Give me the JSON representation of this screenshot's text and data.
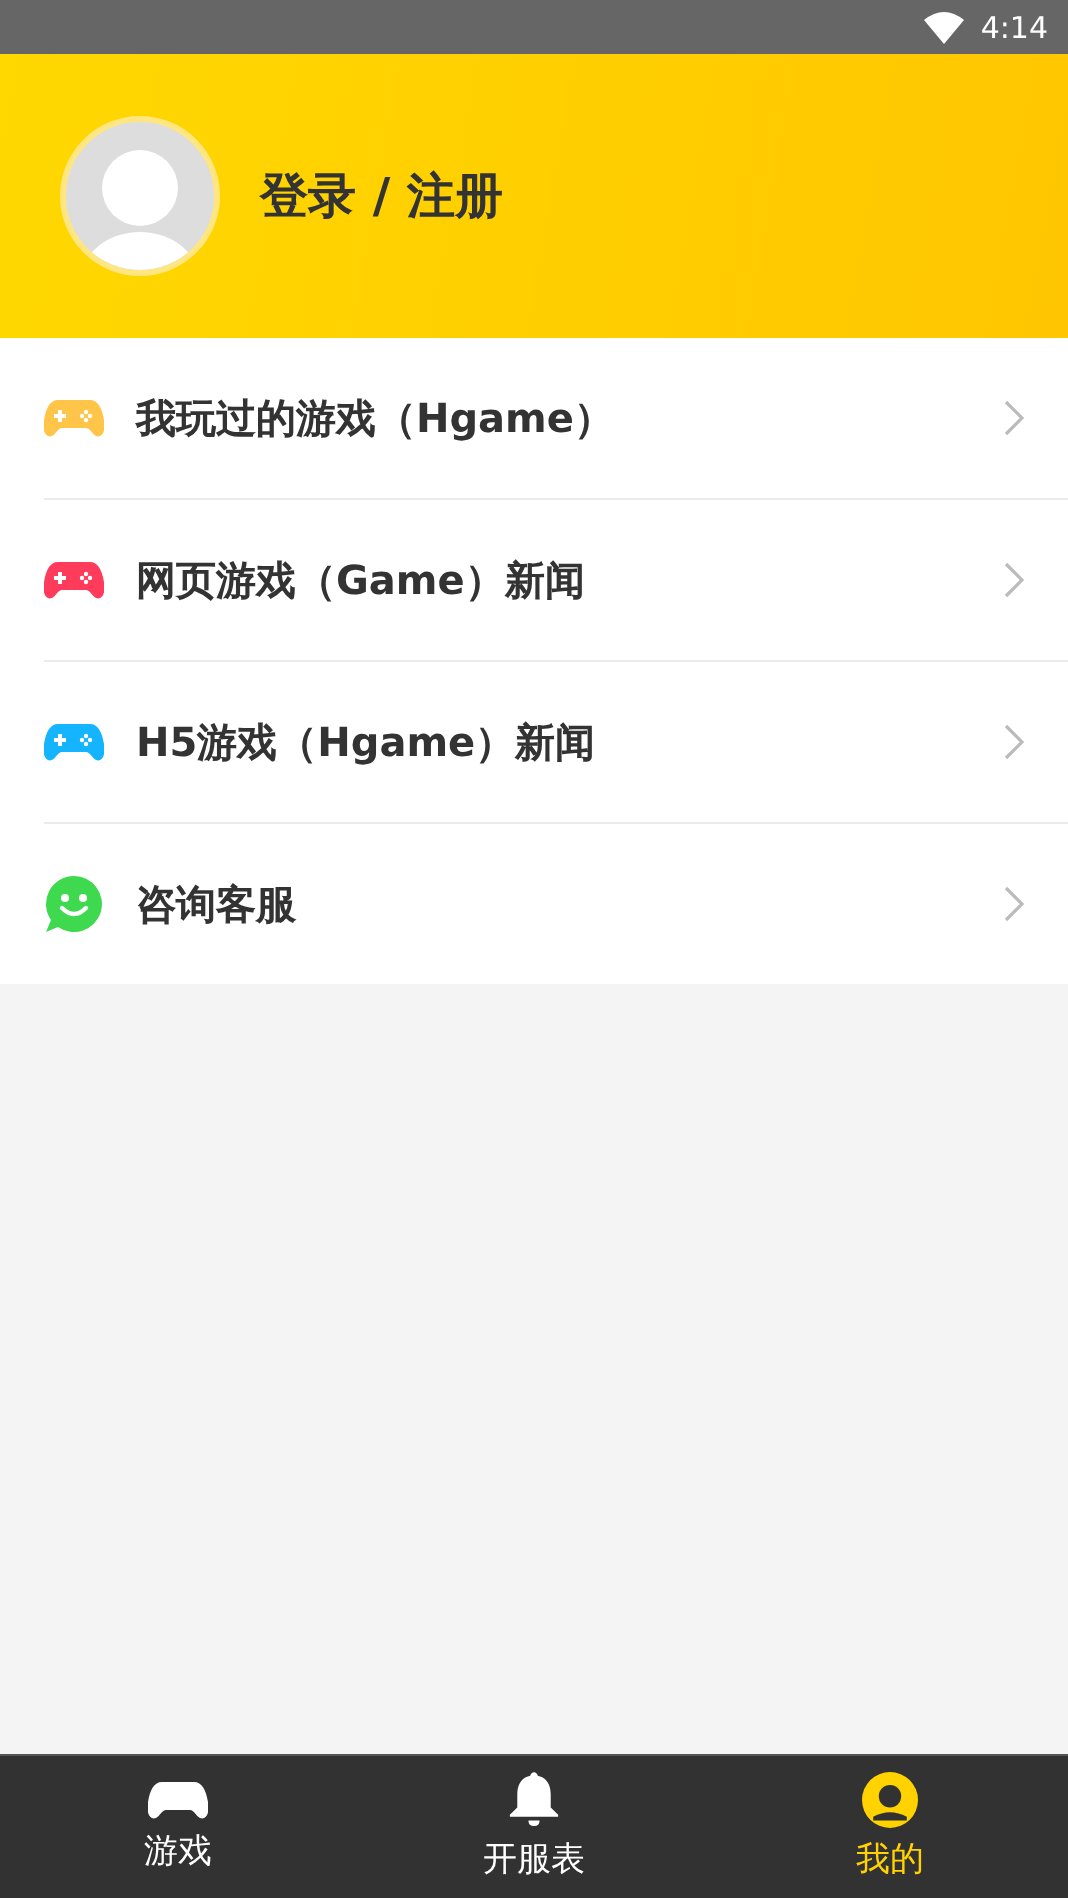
{
  "status_bar": {
    "time": "4:14"
  },
  "header": {
    "login_label": "登录 / 注册"
  },
  "menu": [
    {
      "label": "我玩过的游戏（Hgame）",
      "kind": "gamepad",
      "color": "#ffc549"
    },
    {
      "label": "网页游戏（Game）新闻",
      "kind": "gamepad",
      "color": "#ff3b5c"
    },
    {
      "label": "H5游戏（Hgame）新闻",
      "kind": "gamepad",
      "color": "#14b4ff"
    },
    {
      "label": "咨询客服",
      "kind": "chat",
      "color": "#3fd94f"
    }
  ],
  "tabs": [
    {
      "label": "游戏",
      "kind": "gamepad",
      "selected": false
    },
    {
      "label": "开服表",
      "kind": "bell",
      "selected": false
    },
    {
      "label": "我的",
      "kind": "user",
      "selected": true
    }
  ]
}
